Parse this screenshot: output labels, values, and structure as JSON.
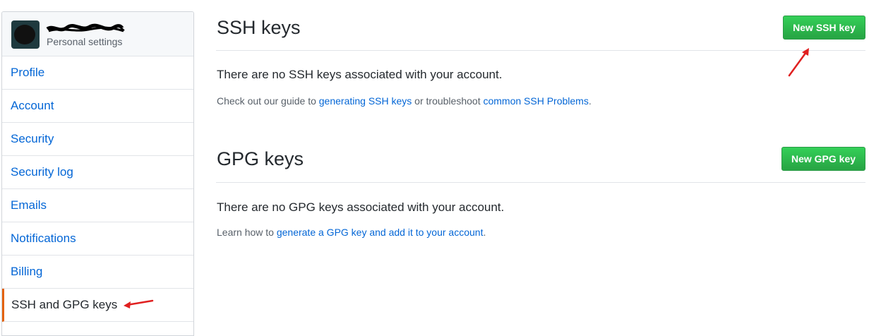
{
  "sidebar": {
    "subtitle": "Personal settings",
    "items": [
      {
        "label": "Profile"
      },
      {
        "label": "Account"
      },
      {
        "label": "Security"
      },
      {
        "label": "Security log"
      },
      {
        "label": "Emails"
      },
      {
        "label": "Notifications"
      },
      {
        "label": "Billing"
      },
      {
        "label": "SSH and GPG keys"
      }
    ],
    "selected_index": 7
  },
  "ssh": {
    "title": "SSH keys",
    "button": "New SSH key",
    "empty": "There are no SSH keys associated with your account.",
    "help_prefix": "Check out our guide to ",
    "help_link1": "generating SSH keys",
    "help_mid": " or troubleshoot ",
    "help_link2": "common SSH Problems",
    "help_suffix": "."
  },
  "gpg": {
    "title": "GPG keys",
    "button": "New GPG key",
    "empty": "There are no GPG keys associated with your account.",
    "help_prefix": "Learn how to ",
    "help_link": "generate a GPG key and add it to your account",
    "help_suffix": "."
  },
  "colors": {
    "link": "#0366d6",
    "button": "#28a745",
    "selected_border": "#e36209",
    "annotation_arrow": "#e02020"
  },
  "icons": {
    "annotation": "red-arrow-icon"
  }
}
